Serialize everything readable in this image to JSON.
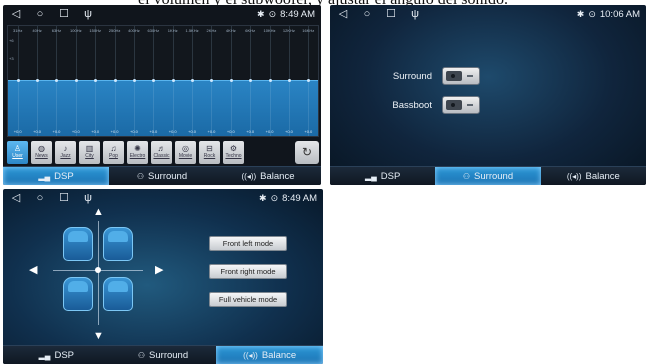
{
  "caption": "el volumen y el subwoofer, y ajustar el ángulo del sonido.",
  "status": {
    "time_dsp": "8:49 AM",
    "time_surround": "10:06 AM",
    "time_balance": "8:49 AM",
    "icons": [
      "bluetooth-icon",
      "location-pin-icon"
    ]
  },
  "nav_icons": [
    "back-triangle-icon",
    "home-circle-icon",
    "recent-square-icon",
    "usb-icon"
  ],
  "tabs": {
    "dsp": "DSP",
    "surround": "Surround",
    "balance": "Balance"
  },
  "dsp": {
    "frequencies": [
      "31Hz",
      "40Hz",
      "63Hz",
      "100Hz",
      "150Hz",
      "250Hz",
      "400Hz",
      "630Hz",
      "1KHz",
      "1.5KHz",
      "2KHz",
      "4KHz",
      "6KHz",
      "10KHz",
      "12KHz",
      "16KHz"
    ],
    "gain_labels": [
      "+6",
      "+3",
      "0",
      "-3",
      "-6"
    ],
    "band_values": [
      "+0.0",
      "+0.0",
      "+0.0",
      "+0.0",
      "+0.0",
      "+0.0",
      "+0.0",
      "+0.0",
      "+0.0",
      "+0.0",
      "+0.0",
      "+0.0",
      "+0.0",
      "+0.0",
      "+0.0",
      "+0.0"
    ],
    "presets": [
      {
        "label": "User",
        "icon": "user-icon",
        "active": true
      },
      {
        "label": "News",
        "icon": "globe-icon"
      },
      {
        "label": "Jazz",
        "icon": "music-note-icon"
      },
      {
        "label": "City",
        "icon": "building-icon"
      },
      {
        "label": "Pop",
        "icon": "guitar-icon"
      },
      {
        "label": "Electro",
        "icon": "electro-icon"
      },
      {
        "label": "Classic",
        "icon": "violin-icon"
      },
      {
        "label": "Movie",
        "icon": "film-icon"
      },
      {
        "label": "Rock",
        "icon": "drum-icon"
      },
      {
        "label": "Techno",
        "icon": "gear-icon"
      }
    ],
    "reset_icon": "reset-icon"
  },
  "surround": {
    "surround_label": "Surround",
    "bassboot_label": "Bassboot"
  },
  "balance": {
    "front_left": "Front left mode",
    "front_right": "Front right mode",
    "full_vehicle": "Full vehicle mode"
  }
}
